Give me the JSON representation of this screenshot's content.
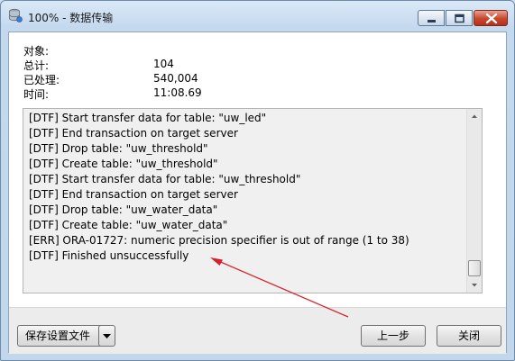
{
  "window": {
    "title": "100% - 数据传输",
    "controls": {
      "minimize": "minimize",
      "maximize": "maximize",
      "close": "close"
    }
  },
  "info": {
    "object_label": "对象:",
    "total_label": "总计:",
    "total_value": "104",
    "processed_label": "已处理:",
    "processed_value": "540,004",
    "time_label": "时间:",
    "time_value": "11:08.69"
  },
  "log": {
    "lines": [
      "[DTF] Start transfer data for table: \"uw_led\"",
      "[DTF] End transaction on target server",
      "[DTF] Drop table: \"uw_threshold\"",
      "[DTF] Create table: \"uw_threshold\"",
      "[DTF] Start transfer data for table: \"uw_threshold\"",
      "[DTF] End transaction on target server",
      "[DTF] Drop table: \"uw_water_data\"",
      "[DTF] Create table: \"uw_water_data\"",
      "[ERR] ORA-01727: numeric precision specifier is out of range (1 to 38)",
      "[DTF] Finished unsuccessfully"
    ]
  },
  "buttons": {
    "save_settings": "保存设置文件",
    "previous": "上一步",
    "close": "关闭"
  },
  "colors": {
    "annotation_arrow": "#d8202a",
    "close_button": "#c8462c"
  }
}
